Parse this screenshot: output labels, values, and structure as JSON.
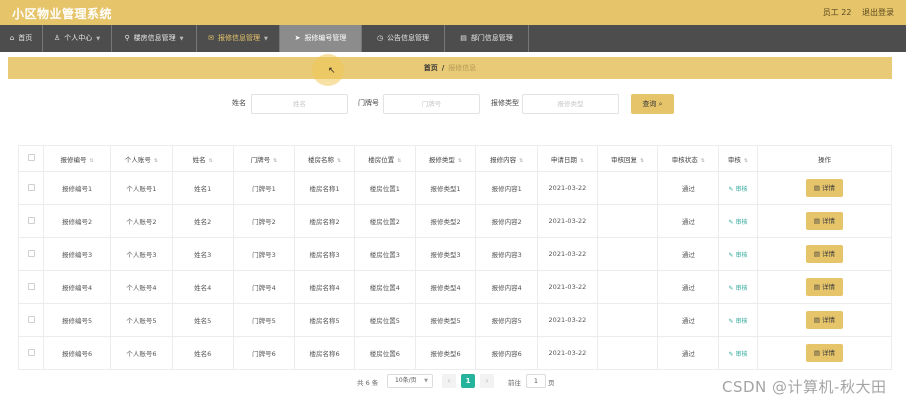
{
  "app": {
    "title": "小区物业管理系统"
  },
  "user": {
    "name": "员工 22",
    "logout": "退出登录"
  },
  "nav": [
    {
      "label": "首页",
      "icon": "home-icon"
    },
    {
      "label": "个人中心",
      "icon": "person-icon"
    },
    {
      "label": "楼房信息管理",
      "icon": "pin-icon"
    },
    {
      "label": "报修信息管理",
      "icon": "mail-icon"
    },
    {
      "label": "报修编号管理",
      "icon": "send-icon"
    },
    {
      "label": "公告信息管理",
      "icon": "clock-icon"
    },
    {
      "label": "部门信息管理",
      "icon": "folder-icon"
    }
  ],
  "breadcrumb": {
    "home": "首页",
    "sep": "/",
    "current": "报修信息"
  },
  "search": {
    "name_label": "姓名",
    "name_placeholder": "姓名",
    "door_label": "门牌号",
    "door_placeholder": "门牌号",
    "type_label": "报修类型",
    "type_placeholder": "报修类型",
    "query_label": "查询"
  },
  "table": {
    "headers": [
      "报修编号",
      "个人账号",
      "姓名",
      "门牌号",
      "楼房名称",
      "楼房位置",
      "报修类型",
      "报修内容",
      "申请日期",
      "审核回复",
      "审核状态",
      "审核",
      "操作"
    ],
    "audit_link": "审核",
    "detail_label": "详情",
    "rows": [
      [
        "报修编号1",
        "个人账号1",
        "姓名1",
        "门牌号1",
        "楼房名称1",
        "楼房位置1",
        "报修类型1",
        "报修内容1",
        "2021-03-22",
        "",
        "通过"
      ],
      [
        "报修编号2",
        "个人账号2",
        "姓名2",
        "门牌号2",
        "楼房名称2",
        "楼房位置2",
        "报修类型2",
        "报修内容2",
        "2021-03-22",
        "",
        "通过"
      ],
      [
        "报修编号3",
        "个人账号3",
        "姓名3",
        "门牌号3",
        "楼房名称3",
        "楼房位置3",
        "报修类型3",
        "报修内容3",
        "2021-03-22",
        "",
        "通过"
      ],
      [
        "报修编号4",
        "个人账号4",
        "姓名4",
        "门牌号4",
        "楼房名称4",
        "楼房位置4",
        "报修类型4",
        "报修内容4",
        "2021-03-22",
        "",
        "通过"
      ],
      [
        "报修编号5",
        "个人账号5",
        "姓名5",
        "门牌号5",
        "楼房名称5",
        "楼房位置5",
        "报修类型5",
        "报修内容5",
        "2021-03-22",
        "",
        "通过"
      ],
      [
        "报修编号6",
        "个人账号6",
        "姓名6",
        "门牌号6",
        "楼房名称6",
        "楼房位置6",
        "报修类型6",
        "报修内容6",
        "2021-03-22",
        "",
        "通过"
      ]
    ]
  },
  "pager": {
    "total": "共 6 条",
    "page_size": "10条/页",
    "prev": "‹",
    "current": "1",
    "next": "›",
    "goto": "前往",
    "goto_value": "1",
    "unit": "页"
  },
  "watermark": "CSDN @计算机-秋大田",
  "colors": {
    "accent": "#e6c46a",
    "nav_bg": "#4d4d4d",
    "pager_active": "#25b49b",
    "audit_link": "#2fa89a"
  }
}
